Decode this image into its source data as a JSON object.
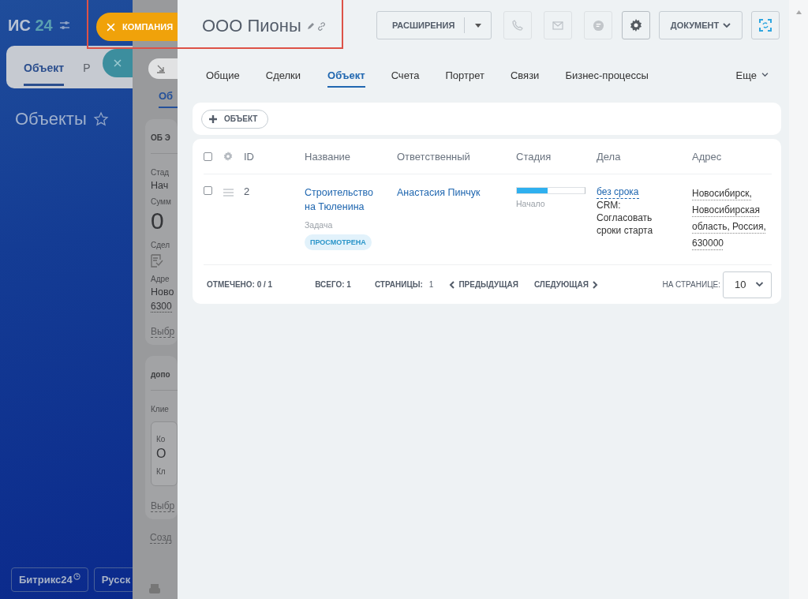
{
  "app_header": {
    "logo_letters": "ИС",
    "logo_number": "24"
  },
  "left_tabs": [
    {
      "label": "Объект",
      "selected": true
    },
    {
      "label": "Р",
      "selected": false
    }
  ],
  "page_title": "Объекты",
  "footer_buttons": [
    {
      "label": "Битрикс24",
      "kind": "brand"
    },
    {
      "label": "Русск",
      "kind": "plain"
    }
  ],
  "slider_label": "КОМПАНИЯ",
  "background_panel": {
    "tab": "Об",
    "cards": [
      {
        "items": [
          {
            "kind": "heading",
            "text": "ОБ Э"
          },
          {
            "kind": "label",
            "text": "Стад"
          },
          {
            "kind": "value",
            "text": "Нач"
          },
          {
            "kind": "label",
            "text": "Сумм"
          },
          {
            "kind": "big",
            "text": "0"
          },
          {
            "kind": "label",
            "text": "Сдел"
          },
          {
            "kind": "doc-icon"
          },
          {
            "kind": "label",
            "text": "Адре"
          },
          {
            "kind": "value",
            "text": "Ново"
          },
          {
            "kind": "address",
            "text": "6300"
          },
          {
            "kind": "link",
            "text": "Выбр"
          }
        ]
      },
      {
        "items": [
          {
            "kind": "heading",
            "text": "допо"
          },
          {
            "kind": "label",
            "text": "Клие"
          },
          {
            "kind": "inner",
            "items": [
              {
                "kind": "label",
                "text": "Ко"
              },
              {
                "kind": "value",
                "text": "О"
              },
              {
                "kind": "label",
                "text": "Кл"
              }
            ]
          },
          {
            "kind": "link",
            "text": "Выбр"
          }
        ]
      }
    ],
    "footer_link": "Созд"
  },
  "slider": {
    "title": "ООО Пионы",
    "extensions_button": "РАСШИРЕНИЯ",
    "document_button": "ДОКУМЕНТ",
    "tabs": [
      {
        "label": "Общие",
        "selected": false
      },
      {
        "label": "Сделки",
        "selected": false
      },
      {
        "label": "Объект",
        "selected": true
      },
      {
        "label": "Счета",
        "selected": false
      },
      {
        "label": "Портрет",
        "selected": false
      },
      {
        "label": "Связи",
        "selected": false
      },
      {
        "label": "Бизнес-процессы",
        "selected": false
      }
    ],
    "more_tab": "Еще",
    "add_button": "ОБЪЕКТ",
    "table": {
      "all_checked": false,
      "columns": [
        "ID",
        "Название",
        "Ответственный",
        "Стадия",
        "Дела",
        "Адрес"
      ],
      "rows": [
        {
          "checked": false,
          "id": "2",
          "name": "Строительство на Тюленина",
          "task_label": "Задача",
          "badge": "ПРОСМОТРЕНА",
          "responsible": "Анастасия Пинчук",
          "stage": {
            "label": "Начало",
            "level": 0.45
          },
          "deadline": "без срока",
          "activity": "CRM: Согласовать сроки старта",
          "address": "Новосибирск, Новосибирская область, Россия, 630000"
        }
      ]
    },
    "footer": {
      "checked": "ОТМЕЧЕНО: 0 / 1",
      "total": "ВСЕГО: 1",
      "pages_label": "СТРАНИЦЫ:",
      "page": "1",
      "prev": "ПРЕДЫДУЩАЯ",
      "next": "СЛЕДУЮЩАЯ",
      "per_page_label": "НА СТРАНИЦЕ:",
      "per_page": "10"
    }
  }
}
